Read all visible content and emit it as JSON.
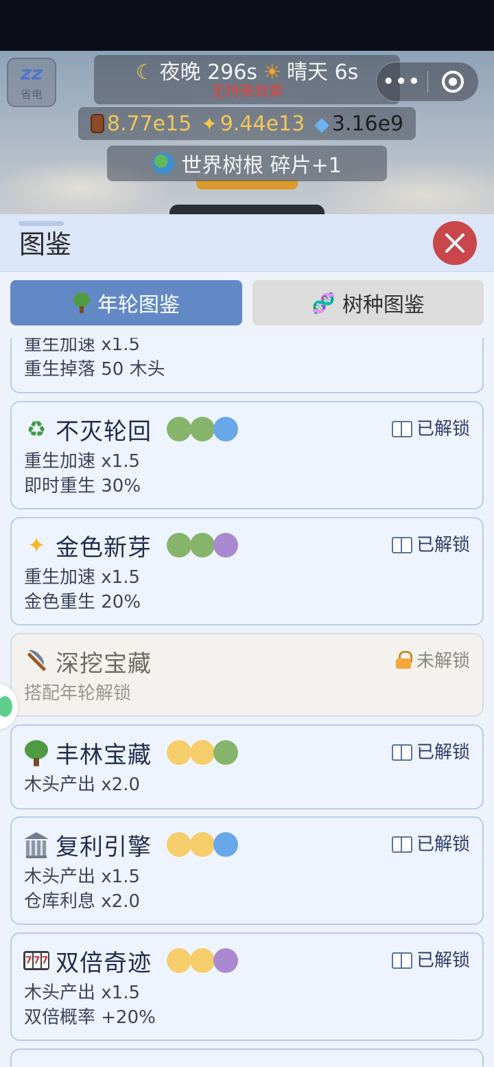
{
  "hud": {
    "sleep_label": "省电",
    "sleep_icon": "zz",
    "weather_time": "夜晚 296s",
    "weather_sky": "晴天 6s",
    "weather_effect": "无特殊效果",
    "wood": "8.77e15",
    "sparkle": "9.44e13",
    "gem": "3.16e9",
    "event_text": "世界树根 碎片+1",
    "capsule_more": "•••"
  },
  "sheet": {
    "title": "图鉴",
    "tabs": [
      {
        "label": "年轮图鉴",
        "active": true
      },
      {
        "label": "树种图鉴",
        "active": false
      }
    ]
  },
  "cards": [
    {
      "name": "",
      "status": "",
      "lines": [
        "重生加速 x1.5",
        "重生掉落 50 木头"
      ]
    },
    {
      "name": "不灭轮回",
      "icon": "recycle-icon",
      "status": "已解锁",
      "dots": [
        "#86b46a",
        "#86b46a",
        "#68a8e8"
      ],
      "lines": [
        "重生加速 x1.5",
        "即时重生 30%"
      ]
    },
    {
      "name": "金色新芽",
      "icon": "sparkle-icon",
      "status": "已解锁",
      "dots": [
        "#86b46a",
        "#86b46a",
        "#a98ad0"
      ],
      "lines": [
        "重生加速 x1.5",
        "金色重生 20%"
      ]
    },
    {
      "name": "深挖宝藏",
      "icon": "pickaxe-icon",
      "status": "未解锁",
      "dots": [],
      "lines": [
        "搭配年轮解锁"
      ]
    },
    {
      "name": "丰林宝藏",
      "icon": "tree-icon",
      "status": "已解锁",
      "dots": [
        "#f5cd6a",
        "#f5cd6a",
        "#86b46a"
      ],
      "lines": [
        "木头产出 x2.0"
      ]
    },
    {
      "name": "复利引擎",
      "icon": "bank-icon",
      "status": "已解锁",
      "dots": [
        "#f5cd6a",
        "#f5cd6a",
        "#68a8e8"
      ],
      "lines": [
        "木头产出 x1.5",
        "仓库利息 x2.0"
      ]
    },
    {
      "name": "双倍奇迹",
      "icon": "slot-machine-icon",
      "status": "已解锁",
      "dots": [
        "#f5cd6a",
        "#f5cd6a",
        "#a98ad0"
      ],
      "lines": [
        "木头产出 x1.5",
        "双倍概率 +20%"
      ]
    }
  ]
}
